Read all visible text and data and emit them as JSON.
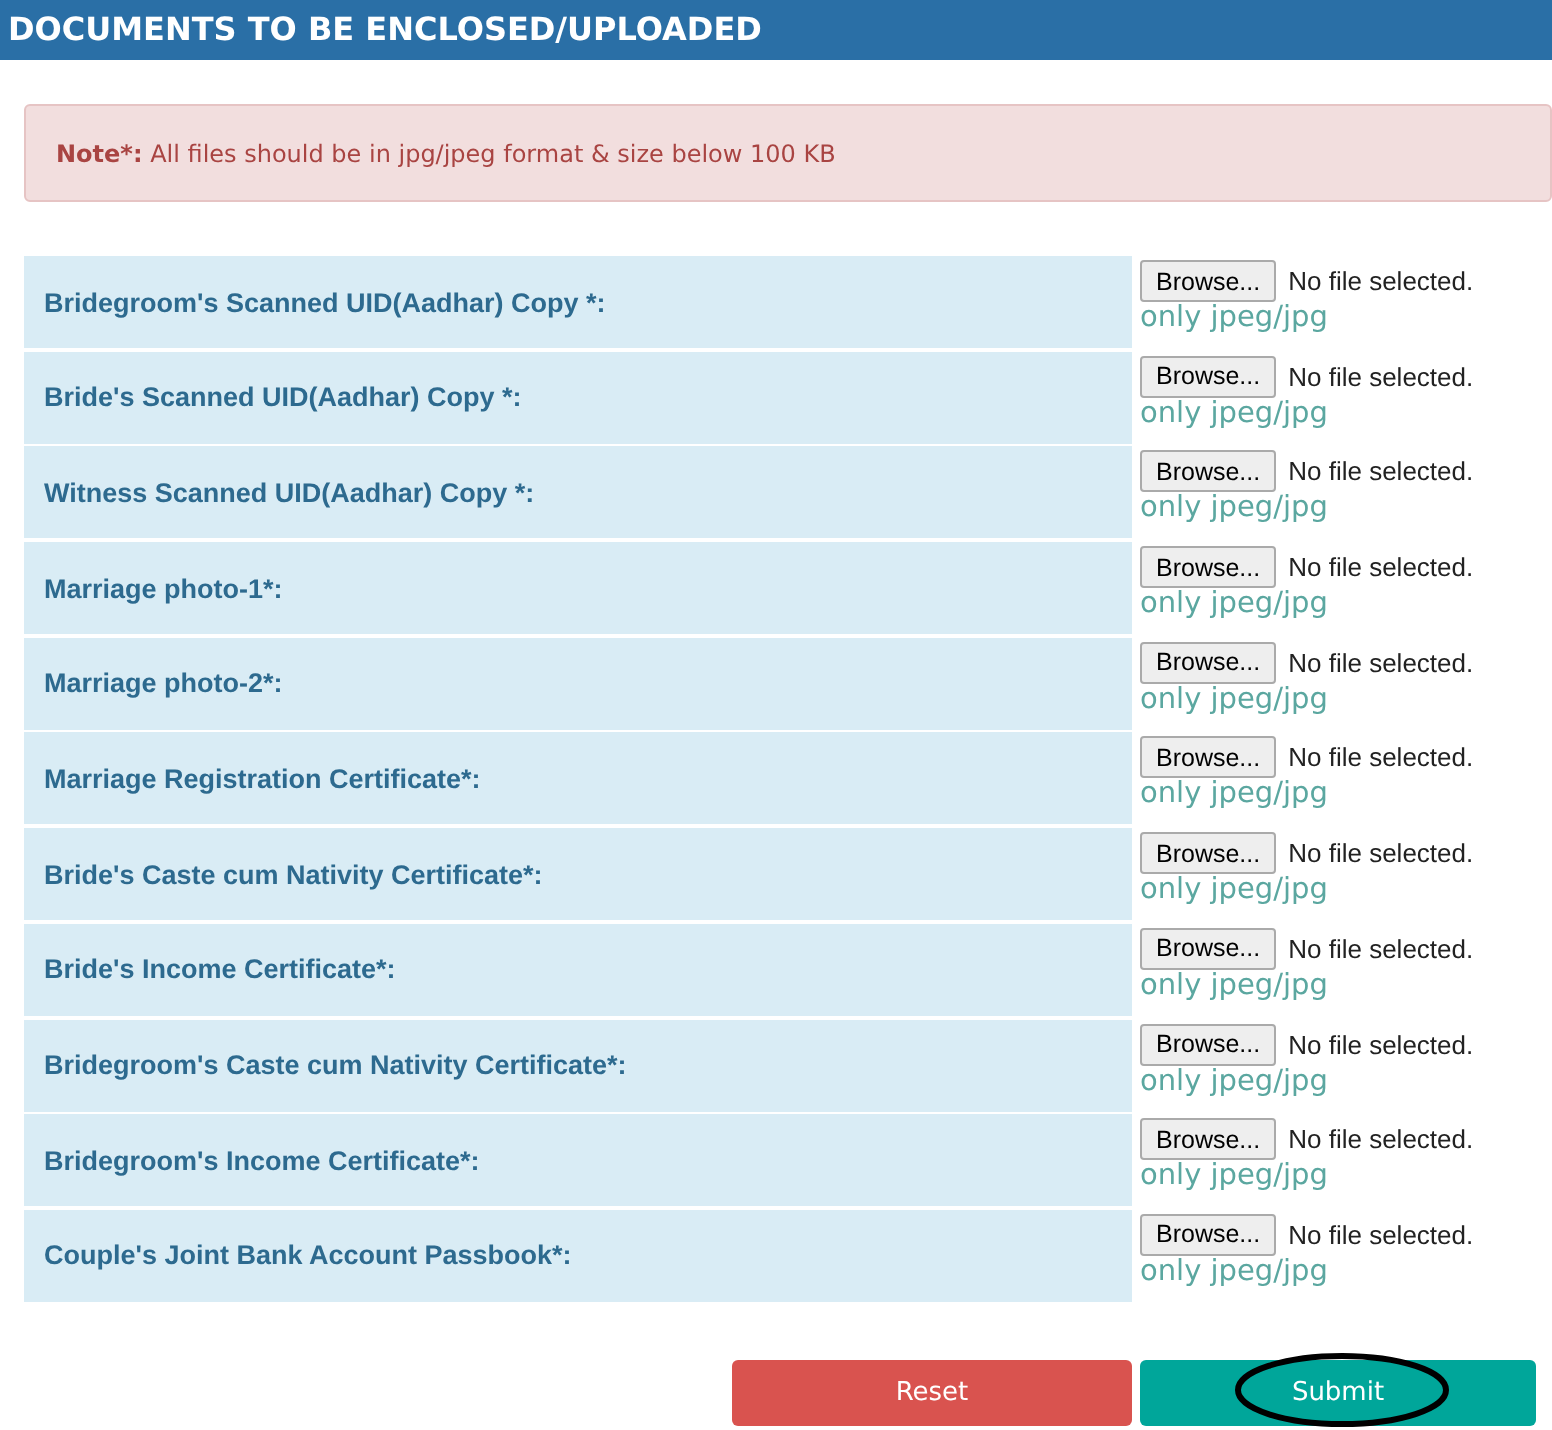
{
  "header": {
    "title": "DOCUMENTS TO BE ENCLOSED/UPLOADED"
  },
  "note": {
    "text": "**Note*:** All files should be in jpg/jpeg format & size below 100 KB"
  },
  "documents": [
    {
      "label": "Bridegroom's Scanned UID(Aadhar) Copy *:",
      "button": "Browse...",
      "status": "No file selected.",
      "hint": "only jpeg/jpg"
    },
    {
      "label": "Bride's Scanned UID(Aadhar) Copy *:",
      "button": "Browse...",
      "status": "No file selected.",
      "hint": "only jpeg/jpg"
    },
    {
      "label": "Witness Scanned UID(Aadhar) Copy *:",
      "button": "Browse...",
      "status": "No file selected.",
      "hint": "only jpeg/jpg"
    },
    {
      "label": "Marriage photo-1*:",
      "button": "Browse...",
      "status": "No file selected.",
      "hint": "only jpeg/jpg"
    },
    {
      "label": "Marriage photo-2*:",
      "button": "Browse...",
      "status": "No file selected.",
      "hint": "only jpeg/jpg"
    },
    {
      "label": "Marriage Registration Certificate*:",
      "button": "Browse...",
      "status": "No file selected.",
      "hint": "only jpeg/jpg"
    },
    {
      "label": "Bride's Caste cum Nativity Certificate*:",
      "button": "Browse...",
      "status": "No file selected.",
      "hint": "only jpeg/jpg"
    },
    {
      "label": "Bride's Income Certificate*:",
      "button": "Browse...",
      "status": "No file selected.",
      "hint": "only jpeg/jpg"
    },
    {
      "label": "Bridegroom's Caste cum Nativity Certificate*:",
      "button": "Browse...",
      "status": "No file selected.",
      "hint": "only jpeg/jpg"
    },
    {
      "label": "Bridegroom's Income Certificate*:",
      "button": "Browse...",
      "status": "No file selected.",
      "hint": "only jpeg/jpg"
    },
    {
      "label": "Couple's Joint Bank Account Passbook*:",
      "button": "Browse...",
      "status": "No file selected.",
      "hint": "only jpeg/jpg"
    }
  ],
  "buttons": [
    {
      "label": "Reset",
      "kind": "reset"
    },
    {
      "label": "Submit",
      "kind": "submit"
    }
  ]
}
